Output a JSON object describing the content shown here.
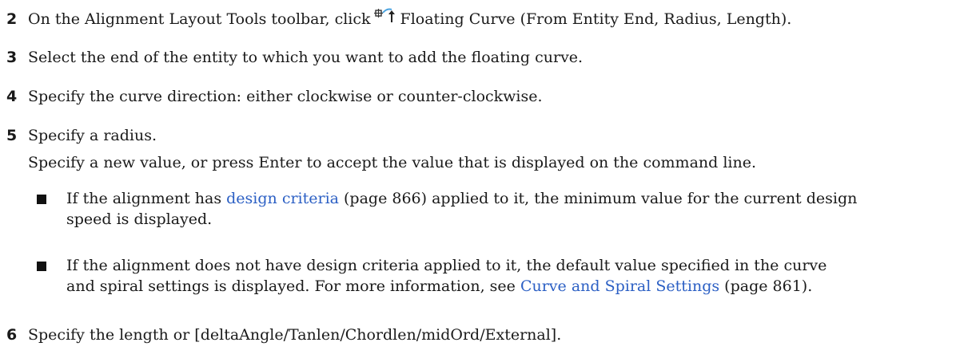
{
  "steps": [
    {
      "num": "2",
      "pre": "On the Alignment Layout Tools toolbar, click",
      "icon": "floating-curve-icon",
      "post": "Floating Curve (From Entity End, Radius, Length)."
    },
    {
      "num": "3",
      "text": "Select the end of the entity to which you want to add the floating curve."
    },
    {
      "num": "4",
      "text": "Specify the curve direction: either clockwise or counter-clockwise."
    },
    {
      "num": "5",
      "text": "Specify a radius."
    },
    {
      "num": "6",
      "text": "Specify the length or [deltaAngle/Tanlen/Chordlen/midOrd/External]."
    }
  ],
  "step5_detail": "Specify a new value, or press Enter to accept the value that is displayed on the command line.",
  "bullets": [
    {
      "pre": "If the alignment has ",
      "link": "design criteria",
      "page": " (page 866) applied to it, the minimum value for the current design",
      "line2": "speed is displayed."
    },
    {
      "line1": "If the alignment does not have design criteria applied to it, the default value specified in the curve",
      "pre2": "and spiral settings is displayed. For more information, see ",
      "link": "Curve and Spiral Settings",
      "page": " (page 861)."
    }
  ],
  "colors": {
    "link": "#2b5fc4",
    "text": "#1a1a1a"
  }
}
